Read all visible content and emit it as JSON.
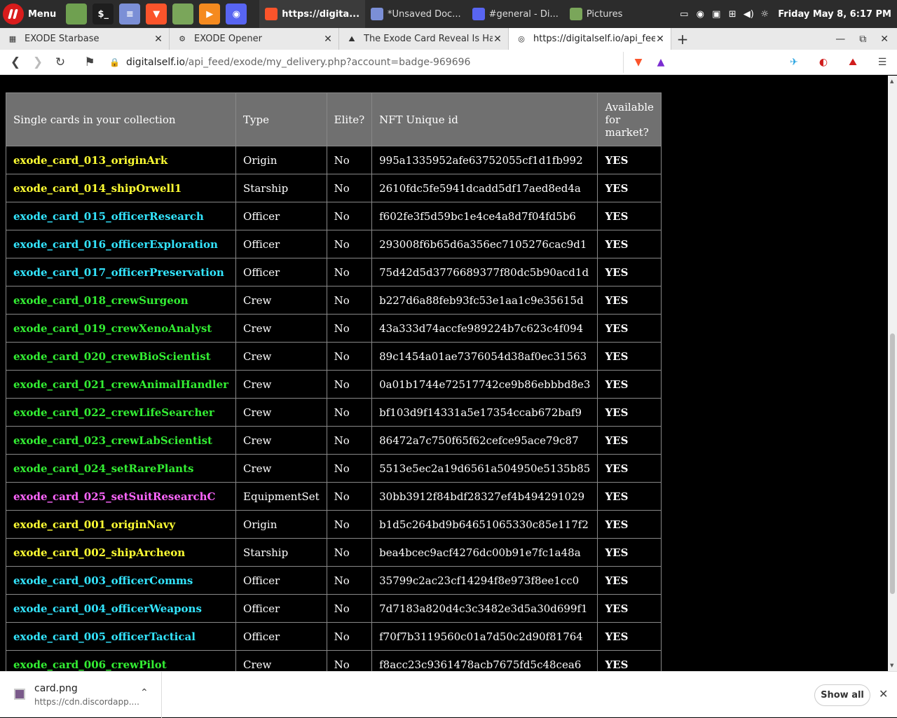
{
  "panel": {
    "menu_label": "Menu",
    "launchers": [
      {
        "name": "files-launcher",
        "glyph": "",
        "color": "#6fa050"
      },
      {
        "name": "terminal-launcher",
        "glyph": "$_",
        "color": "#1e1e1e"
      },
      {
        "name": "text-editor-launcher",
        "glyph": "≡",
        "color": "#7b8fd6"
      },
      {
        "name": "brave-launcher",
        "glyph": "▼",
        "color": "#fb542b"
      },
      {
        "name": "folder-launcher",
        "glyph": "",
        "color": "#7aa65a"
      },
      {
        "name": "media-player-launcher",
        "glyph": "▶",
        "color": "#f58a1f"
      },
      {
        "name": "discord-launcher",
        "glyph": "◉",
        "color": "#5865f2"
      }
    ],
    "tasks": [
      {
        "label": "https://digita...",
        "color": "#fb542b",
        "active": true
      },
      {
        "label": "*Unsaved Doc...",
        "color": "#7b8fd6",
        "active": false
      },
      {
        "label": "#general - Di...",
        "color": "#5865f2",
        "active": false
      },
      {
        "label": "Pictures",
        "color": "#7aa65a",
        "active": false
      }
    ],
    "clock": "Friday May 8, 6:17 PM"
  },
  "tabs": [
    {
      "title": "EXODE Starbase",
      "icon": "exode-icon",
      "active": false
    },
    {
      "title": "EXODE Opener",
      "icon": "settings-icon",
      "active": false
    },
    {
      "title": "The Exode Card Reveal Is Happ",
      "icon": "hive-icon",
      "active": false
    },
    {
      "title": "https://digitalself.io/api_feed/e",
      "icon": "globe-icon",
      "active": true
    }
  ],
  "toolbar": {
    "url_host": "digitalself.io",
    "url_path": "/api_feed/exode/my_delivery.php?account=badge-969696"
  },
  "table": {
    "headers": [
      "Single cards in your collection",
      "Type",
      "Elite?",
      "NFT Unique id",
      "Available for market?"
    ],
    "rows": [
      {
        "name": "exode_card_013_originArk",
        "type": "Origin",
        "elite": "No",
        "nft": "995a1335952afe63752055cf1d1fb992",
        "avail": "YES",
        "color": "#ffff33"
      },
      {
        "name": "exode_card_014_shipOrwell1",
        "type": "Starship",
        "elite": "No",
        "nft": "2610fdc5fe5941dcadd5df17aed8ed4a",
        "avail": "YES",
        "color": "#ffff33"
      },
      {
        "name": "exode_card_015_officerResearch",
        "type": "Officer",
        "elite": "No",
        "nft": "f602fe3f5d59bc1e4ce4a8d7f04fd5b6",
        "avail": "YES",
        "color": "#33e5ff"
      },
      {
        "name": "exode_card_016_officerExploration",
        "type": "Officer",
        "elite": "No",
        "nft": "293008f6b65d6a356ec7105276cac9d1",
        "avail": "YES",
        "color": "#33e5ff"
      },
      {
        "name": "exode_card_017_officerPreservation",
        "type": "Officer",
        "elite": "No",
        "nft": "75d42d5d3776689377f80dc5b90acd1d",
        "avail": "YES",
        "color": "#33e5ff"
      },
      {
        "name": "exode_card_018_crewSurgeon",
        "type": "Crew",
        "elite": "No",
        "nft": "b227d6a88feb93fc53e1aa1c9e35615d",
        "avail": "YES",
        "color": "#33ee33"
      },
      {
        "name": "exode_card_019_crewXenoAnalyst",
        "type": "Crew",
        "elite": "No",
        "nft": "43a333d74accfe989224b7c623c4f094",
        "avail": "YES",
        "color": "#33ee33"
      },
      {
        "name": "exode_card_020_crewBioScientist",
        "type": "Crew",
        "elite": "No",
        "nft": "89c1454a01ae7376054d38af0ec31563",
        "avail": "YES",
        "color": "#33ee33"
      },
      {
        "name": "exode_card_021_crewAnimalHandler",
        "type": "Crew",
        "elite": "No",
        "nft": "0a01b1744e72517742ce9b86ebbbd8e3",
        "avail": "YES",
        "color": "#33ee33"
      },
      {
        "name": "exode_card_022_crewLifeSearcher",
        "type": "Crew",
        "elite": "No",
        "nft": "bf103d9f14331a5e17354ccab672baf9",
        "avail": "YES",
        "color": "#33ee33"
      },
      {
        "name": "exode_card_023_crewLabScientist",
        "type": "Crew",
        "elite": "No",
        "nft": "86472a7c750f65f62cefce95ace79c87",
        "avail": "YES",
        "color": "#33ee33"
      },
      {
        "name": "exode_card_024_setRarePlants",
        "type": "Crew",
        "elite": "No",
        "nft": "5513e5ec2a19d6561a504950e5135b85",
        "avail": "YES",
        "color": "#33ee33"
      },
      {
        "name": "exode_card_025_setSuitResearchC",
        "type": "EquipmentSet",
        "elite": "No",
        "nft": "30bb3912f84bdf28327ef4b494291029",
        "avail": "YES",
        "color": "#ff66ff"
      },
      {
        "name": "exode_card_001_originNavy",
        "type": "Origin",
        "elite": "No",
        "nft": "b1d5c264bd9b64651065330c85e117f2",
        "avail": "YES",
        "color": "#ffff33"
      },
      {
        "name": "exode_card_002_shipArcheon",
        "type": "Starship",
        "elite": "No",
        "nft": "bea4bcec9acf4276dc00b91e7fc1a48a",
        "avail": "YES",
        "color": "#ffff33"
      },
      {
        "name": "exode_card_003_officerComms",
        "type": "Officer",
        "elite": "No",
        "nft": "35799c2ac23cf14294f8e973f8ee1cc0",
        "avail": "YES",
        "color": "#33e5ff"
      },
      {
        "name": "exode_card_004_officerWeapons",
        "type": "Officer",
        "elite": "No",
        "nft": "7d7183a820d4c3c3482e3d5a30d699f1",
        "avail": "YES",
        "color": "#33e5ff"
      },
      {
        "name": "exode_card_005_officerTactical",
        "type": "Officer",
        "elite": "No",
        "nft": "f70f7b3119560c01a7d50c2d90f81764",
        "avail": "YES",
        "color": "#33e5ff"
      },
      {
        "name": "exode_card_006_crewPilot",
        "type": "Crew",
        "elite": "No",
        "nft": "f8acc23c9361478acb7675fd5c48cea6",
        "avail": "YES",
        "color": "#33ee33"
      }
    ]
  },
  "download": {
    "filename": "card.png",
    "source": "https://cdn.discordapp....",
    "show_all": "Show all"
  }
}
